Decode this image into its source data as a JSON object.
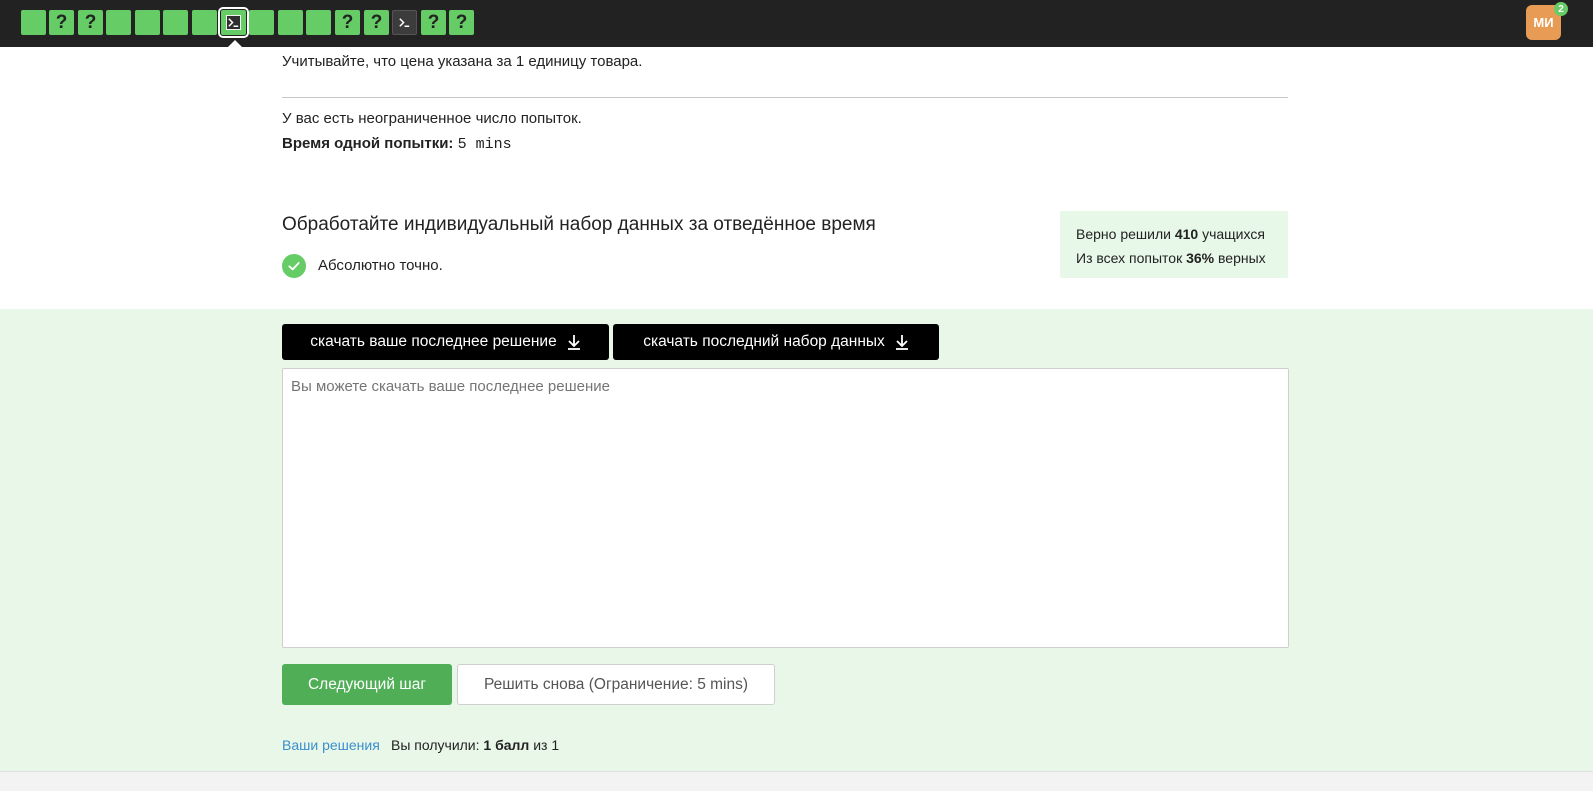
{
  "steps": [
    {
      "kind": "done"
    },
    {
      "kind": "question",
      "symbol": "?"
    },
    {
      "kind": "question",
      "symbol": "?"
    },
    {
      "kind": "done"
    },
    {
      "kind": "done"
    },
    {
      "kind": "done"
    },
    {
      "kind": "done"
    },
    {
      "kind": "terminal-current",
      "icon": "terminal-icon"
    },
    {
      "kind": "done"
    },
    {
      "kind": "done"
    },
    {
      "kind": "done"
    },
    {
      "kind": "question",
      "symbol": "?"
    },
    {
      "kind": "question",
      "symbol": "?"
    },
    {
      "kind": "terminal",
      "icon": "terminal-icon"
    },
    {
      "kind": "question",
      "symbol": "?"
    },
    {
      "kind": "question",
      "symbol": "?"
    }
  ],
  "user": {
    "initials": "МИ",
    "badge": "2",
    "avatar_color": "#e89b55"
  },
  "step_text": {
    "price_note": "Учитывайте, что цена указана за 1 единицу товара.",
    "attempts": "У вас есть неограниченное число попыток.",
    "time_label": "Время одной попытки:",
    "time_value": "5 mins"
  },
  "dataset": {
    "title": "Обработайте индивидуальный набор данных за отведённое время",
    "status": "Абсолютно точно.",
    "stats": {
      "line1_prefix": "Верно решили ",
      "solved_count": "410",
      "line1_suffix": " учащихся",
      "line2_prefix": "Из всех попыток ",
      "percent": "36%",
      "line2_suffix": " верных"
    },
    "download_solution_label": "скачать ваше последнее решение",
    "download_dataset_label": "скачать последний набор данных",
    "reply_placeholder": "Вы можете скачать ваше последнее решение",
    "next_label": "Следующий шаг",
    "retry_label": "Решить снова (Ограничение: 5 mins)",
    "solutions_link": "Ваши решения",
    "score_prefix": "Вы получили: ",
    "score_value": "1 балл",
    "score_suffix": " из 1"
  },
  "colors": {
    "accent_green": "#66cc66",
    "button_green": "#4fae56",
    "panel_green": "#e9f7e9",
    "link_blue": "#3a8fcc"
  }
}
